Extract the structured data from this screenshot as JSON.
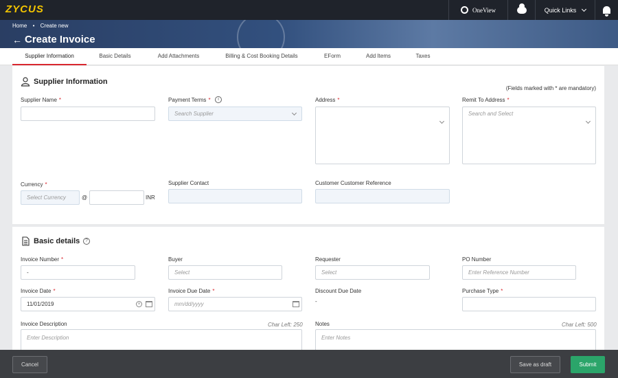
{
  "topbar": {
    "logo": "ZYCUS",
    "oneview": "OneView",
    "quick_links": "Quick Links",
    "icons": [
      "oneview-icon",
      "cloud-icon",
      "chevron-down-icon",
      "bell-icon"
    ]
  },
  "breadcrumb": {
    "home": "Home",
    "sep": "•",
    "current": "Create new"
  },
  "page": {
    "back": "←",
    "title": "Create Invoice"
  },
  "tabs": [
    {
      "label": "Supplier Information"
    },
    {
      "label": "Basic Details"
    },
    {
      "label": "Add Attachments"
    },
    {
      "label": "Billing & Cost Booking Details"
    },
    {
      "label": "EForm"
    },
    {
      "label": "Add Items"
    },
    {
      "label": "Taxes"
    }
  ],
  "supplier": {
    "title": "Supplier Information",
    "mandatory_note": "(Fields marked with * are mandatory)",
    "supplier_name_label": "Supplier Name",
    "payment_terms_label": "Payment Terms",
    "payment_terms_placeholder": "Search Supplier",
    "address_label": "Address",
    "remit_label": "Remit To Address",
    "remit_placeholder": "Search and Select",
    "currency_label": "Currency",
    "currency_placeholder": "Select Currency",
    "at": "@",
    "currency_unit": "INR",
    "supplier_contact_label": "Supplier Contact",
    "customer_ref_label": "Customer Customer Reference"
  },
  "basic": {
    "title": "Basic details",
    "invoice_number_label": "Invoice Number",
    "invoice_number_value": "-",
    "buyer_label": "Buyer",
    "buyer_placeholder": "Select",
    "requester_label": "Requester",
    "requester_placeholder": "Select",
    "po_label": "PO Number",
    "po_placeholder": "Enter Reference Number",
    "invoice_date_label": "Invoice Date",
    "invoice_date_value": "11/01/2019",
    "due_date_label": "Invoice Due Date",
    "due_date_placeholder": "mm/dd/yyyy",
    "discount_label": "Discount Due Date",
    "discount_value": "-",
    "purchase_type_label": "Purchase Type",
    "description_label": "Invoice Description",
    "description_charleft": "Char Left: 250",
    "description_placeholder": "Enter Description",
    "notes_label": "Notes",
    "notes_charleft": "Char Left: 500",
    "notes_placeholder": "Enter Notes"
  },
  "footer": {
    "cancel": "Cancel",
    "draft": "Save as draft",
    "submit": "Submit"
  },
  "colors": {
    "accent_red": "#d9272e",
    "submit_green": "#2ba56a",
    "logo_yellow": "#f3c400"
  }
}
